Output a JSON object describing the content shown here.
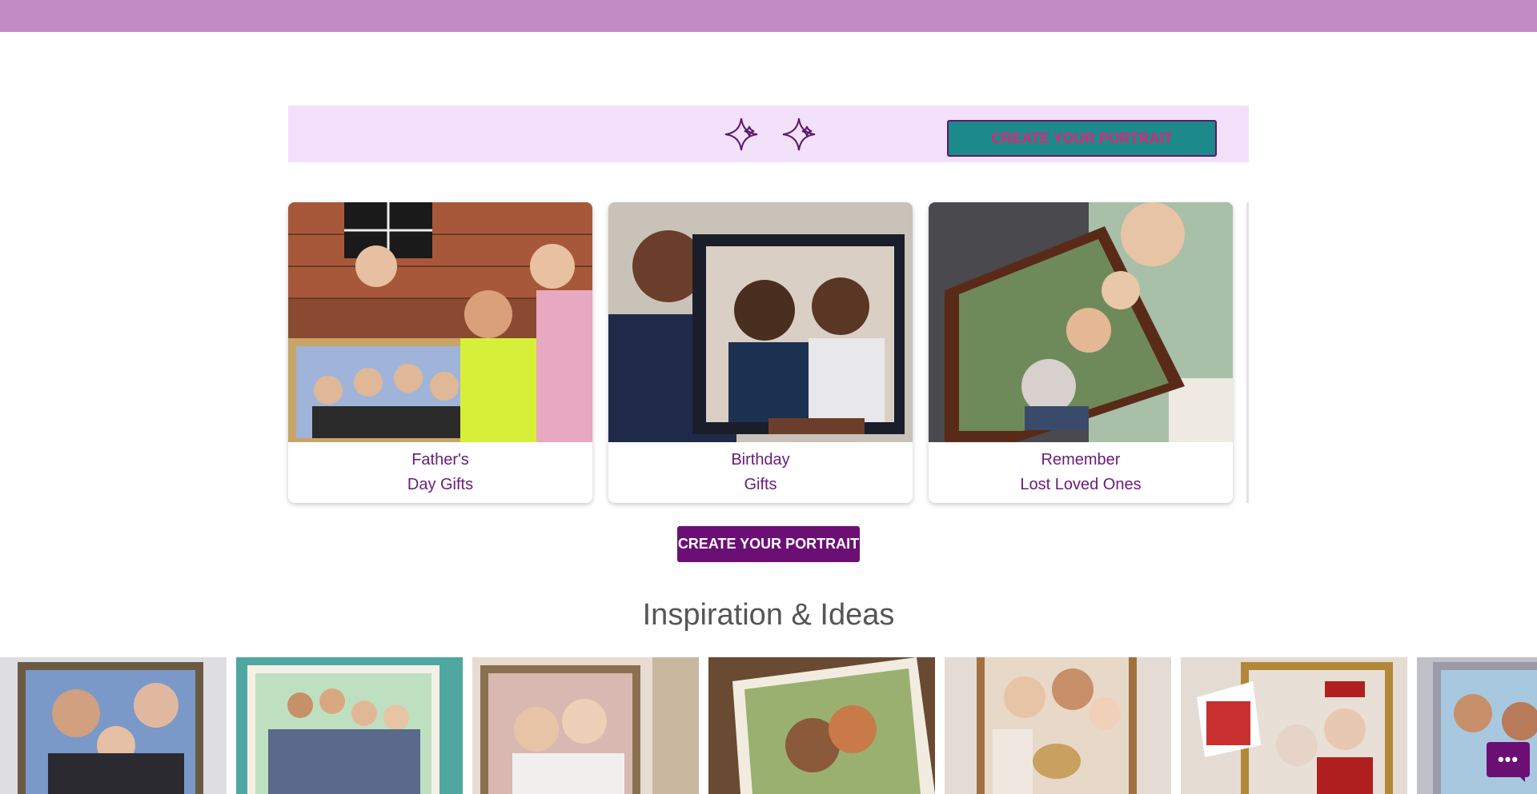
{
  "colors": {
    "topbar": "#c38bc6",
    "promo_bg": "#f3e0fb",
    "promo_button": "#1c8a8a",
    "promo_button_text": "#e0247c",
    "accent": "#6b0f75",
    "caption": "#6a1a7a"
  },
  "promo": {
    "icon": "sparkles-icon",
    "button_label": "CREATE YOUR PORTRAIT"
  },
  "cards": [
    {
      "line1": "Father's",
      "line2": "Day Gifts",
      "image": "family-holding-framed-portrait"
    },
    {
      "line1": "Birthday",
      "line2": "Gifts",
      "image": "man-holding-framed-portrait"
    },
    {
      "line1": "Remember",
      "line2": "Lost Loved Ones",
      "image": "woman-holding-framed-portrait"
    }
  ],
  "cta_label": "CREATE YOUR PORTRAIT",
  "section_title": "Inspiration & Ideas",
  "gallery": [
    "portrait-grandfather-father-son",
    "portrait-large-family",
    "portrait-bride-grandmother",
    "portrait-couple-embrace",
    "portrait-family-with-baby-dog",
    "portrait-graduate-grandmother",
    "portrait-women-outdoors"
  ],
  "chat": {
    "icon": "chat-icon",
    "label": "•••"
  }
}
